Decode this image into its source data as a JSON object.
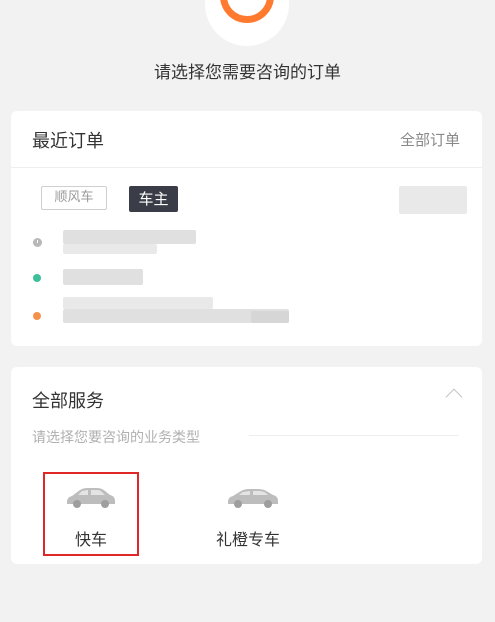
{
  "header": {
    "prompt": "请选择您需要咨询的订单"
  },
  "recent_orders": {
    "title": "最近订单",
    "all_orders_link": "全部订单",
    "tags": {
      "hitch": "顺风车",
      "driver": "车主"
    }
  },
  "services": {
    "title": "全部服务",
    "subtitle": "请选择您要咨询的业务类型",
    "items": [
      {
        "label": "快车",
        "icon": "car-icon"
      },
      {
        "label": "礼橙专车",
        "icon": "car-icon"
      }
    ]
  },
  "colors": {
    "brand_orange": "#ff7a2e",
    "selected_border": "#e02727",
    "dark_tag": "#3a3d48",
    "dot_green": "#3cbf9a",
    "dot_orange": "#f4924d"
  }
}
